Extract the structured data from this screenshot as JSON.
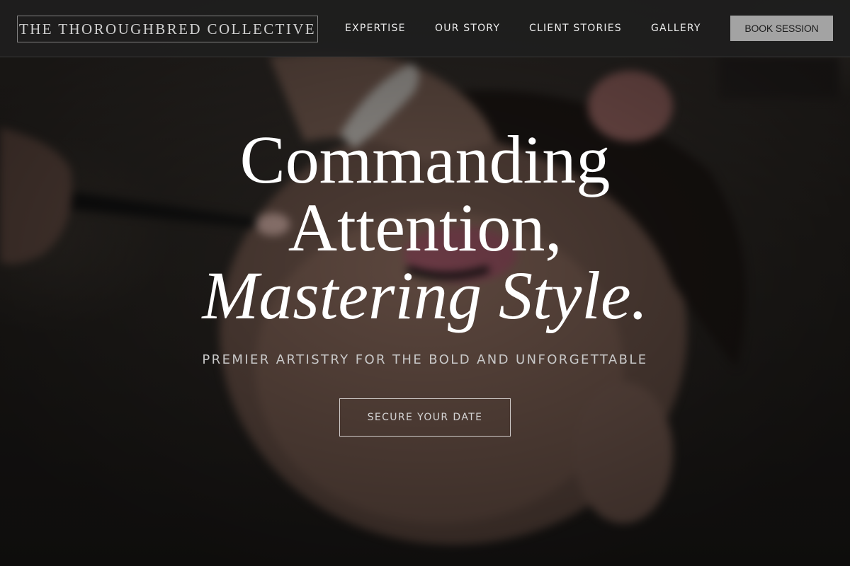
{
  "header": {
    "logo": "THE THOROUGHBRED COLLECTIVE",
    "nav": [
      "EXPERTISE",
      "OUR STORY",
      "CLIENT STORIES",
      "GALLERY"
    ],
    "book_button": "BOOK SESSION"
  },
  "hero": {
    "headline_line1": "Commanding",
    "headline_line2": "Attention,",
    "headline_line3": "Mastering Style.",
    "subtitle": "PREMIER ARTISTRY FOR THE BOLD AND UNFORGETTABLE",
    "cta_button": "SECURE YOUR DATE",
    "background_image": "makeup-artist-applying-makeup-photo"
  },
  "colors": {
    "header_bg": "#1e1e1e",
    "book_button_bg": "#a3a3a3",
    "headline": "#ffffff",
    "subtitle": "#c9c9c9"
  }
}
